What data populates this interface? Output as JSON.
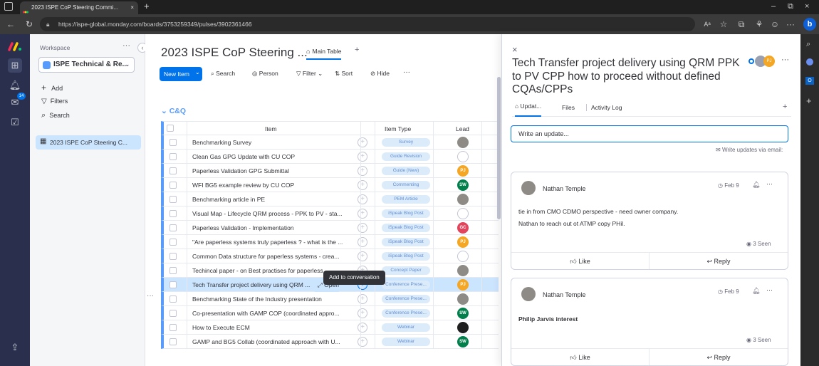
{
  "browser": {
    "tab_title": "2023 ISPE CoP Steering Commi...",
    "url": "https://ispe-global.monday.com/boards/3753259349/pulses/3902361466",
    "new_tab": "+",
    "window_controls": [
      "–",
      "⧉",
      "×"
    ]
  },
  "workspace": {
    "label": "Workspace",
    "name": "ISPE Technical & Re...",
    "actions": [
      {
        "icon": "plus-icon",
        "label": "Add"
      },
      {
        "icon": "filter-icon",
        "label": "Filters"
      },
      {
        "icon": "search-icon",
        "label": "Search"
      }
    ],
    "board_item": "2023 ISPE CoP Steering C..."
  },
  "rail": {
    "notification_count": "14"
  },
  "board": {
    "title": "2023 ISPE CoP Steering ...",
    "view_tab": "Main Table",
    "add_view": "+",
    "toolbar": {
      "new_item": "New Item",
      "search": "Search",
      "person": "Person",
      "filter": "Filter",
      "sort": "Sort",
      "hide": "Hide",
      "more": "···"
    },
    "group_name": "C&Q",
    "columns": {
      "item": "Item",
      "type": "Item Type",
      "lead": "Lead"
    },
    "tooltip": "Add to conversation",
    "open_label": "Open",
    "row_menu": "···",
    "rows": [
      {
        "name": "Benchmarking Survey",
        "type": "Survey",
        "lead": "photo"
      },
      {
        "name": "Clean Gas GPG Update with CU COP",
        "type": "Guide Revision",
        "lead": "empty"
      },
      {
        "name": "Paperless Validation GPG Submittal",
        "type": "Guide (New)",
        "lead": "PJ"
      },
      {
        "name": "WFI BG5 example review by CU COP",
        "type": "Commenting",
        "lead": "SW"
      },
      {
        "name": "Benchmarking article in PE",
        "type": "PEM Article",
        "lead": "photo"
      },
      {
        "name": "Visual Map - Lifecycle QRM process - PPK to PV - sta...",
        "type": "iSpeak Blog Post",
        "lead": "empty"
      },
      {
        "name": "Paperless Validation - Implementation",
        "type": "iSpeak Blog Post",
        "lead": "GC"
      },
      {
        "name": "\"Are paperless systems truly paperless ? - what is the ...",
        "type": "iSpeak Blog Post",
        "lead": "PJ"
      },
      {
        "name": "Common Data structure for paperless systems - crea...",
        "type": "iSpeak Blog Post",
        "lead": "empty"
      },
      {
        "name": "Techincal paper - on Best practises for paperless",
        "type": "Concept Paper",
        "lead": "photo"
      },
      {
        "name": "Tech Transfer project delivery using QRM ...",
        "type": "Conference Prese...",
        "lead": "PJ"
      },
      {
        "name": "Benchmarking State of the Industry presentation",
        "type": "Conference Prese...",
        "lead": "photo"
      },
      {
        "name": "Co-presentation with GAMP COP (coordinated appro...",
        "type": "Conference Prese...",
        "lead": "SW"
      },
      {
        "name": "How to Execute ECM",
        "type": "Webinar",
        "lead": "dark"
      },
      {
        "name": "GAMP and BG5 Collab (coordinated approach with U...",
        "type": "Webinar",
        "lead": "SW"
      }
    ]
  },
  "detail": {
    "close": "×",
    "title": "Tech Transfer project delivery using QRM PPK to PV CPP how to proceed without defined CQAs/CPPs",
    "more": "···",
    "avatar_initials": "PJ",
    "tabs": [
      "Updat...",
      "Files",
      "Activity Log"
    ],
    "tab_add": "+",
    "update_placeholder": "Write an update...",
    "email_link": "Write updates via email:",
    "updates": [
      {
        "author": "Nathan Temple",
        "date": "Feb 9",
        "lines": [
          "tie in from CMO CDMO perspective - need owner company.",
          "Nathan to reach out ot ATMP copy PHil."
        ],
        "seen": "3 Seen",
        "like": "Like",
        "reply": "Reply"
      },
      {
        "author": "Nathan Temple",
        "date": "Feb 9",
        "lines": [
          "Philip Jarvis interest"
        ],
        "seen": "3 Seen",
        "like": "Like",
        "reply": "Reply"
      }
    ]
  },
  "colors": {
    "accent": "#0073ea",
    "rail": "#292f4c",
    "group": "#579bfc",
    "selected_row": "#cce5ff"
  }
}
